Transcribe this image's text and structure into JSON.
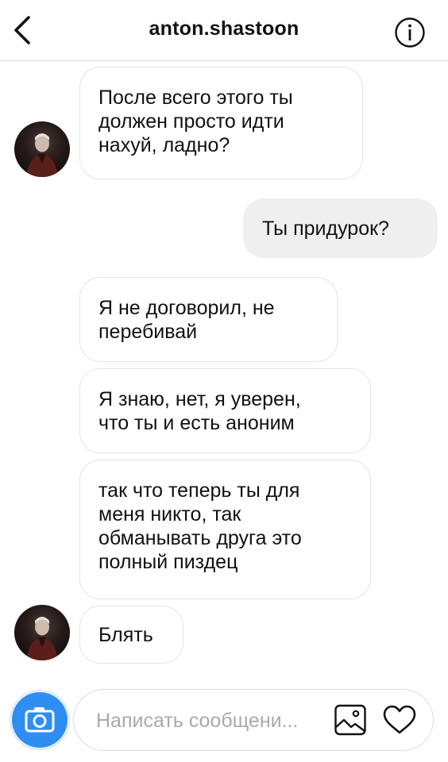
{
  "header": {
    "title": "anton.shastoon",
    "back_icon": "chevron-left-icon",
    "info_icon": "info-icon"
  },
  "messages": [
    {
      "direction": "incoming",
      "text": "После всего этого ты\nдолжен просто идти\nнахуй, ладно?"
    },
    {
      "direction": "outgoing",
      "text": "Ты придурок?"
    },
    {
      "direction": "incoming",
      "text": "Я не договорил, не\nперебивай"
    },
    {
      "direction": "incoming",
      "text": "Я знаю, нет, я уверен,\nчто ты и есть аноним"
    },
    {
      "direction": "incoming",
      "text": "так что теперь ты для\nменя никто, так\nобманывать друга это\nполный пиздец"
    },
    {
      "direction": "incoming",
      "text": "Блять"
    }
  ],
  "composer": {
    "placeholder": "Написать сообщени...",
    "value": "",
    "camera_icon": "camera-icon",
    "gallery_icon": "image-icon",
    "like_icon": "heart-icon"
  },
  "colors": {
    "accent": "#2f8ef2",
    "outgoing_bubble": "#efefef",
    "incoming_border": "#e3e3e3",
    "divider": "#dbdbdb"
  }
}
